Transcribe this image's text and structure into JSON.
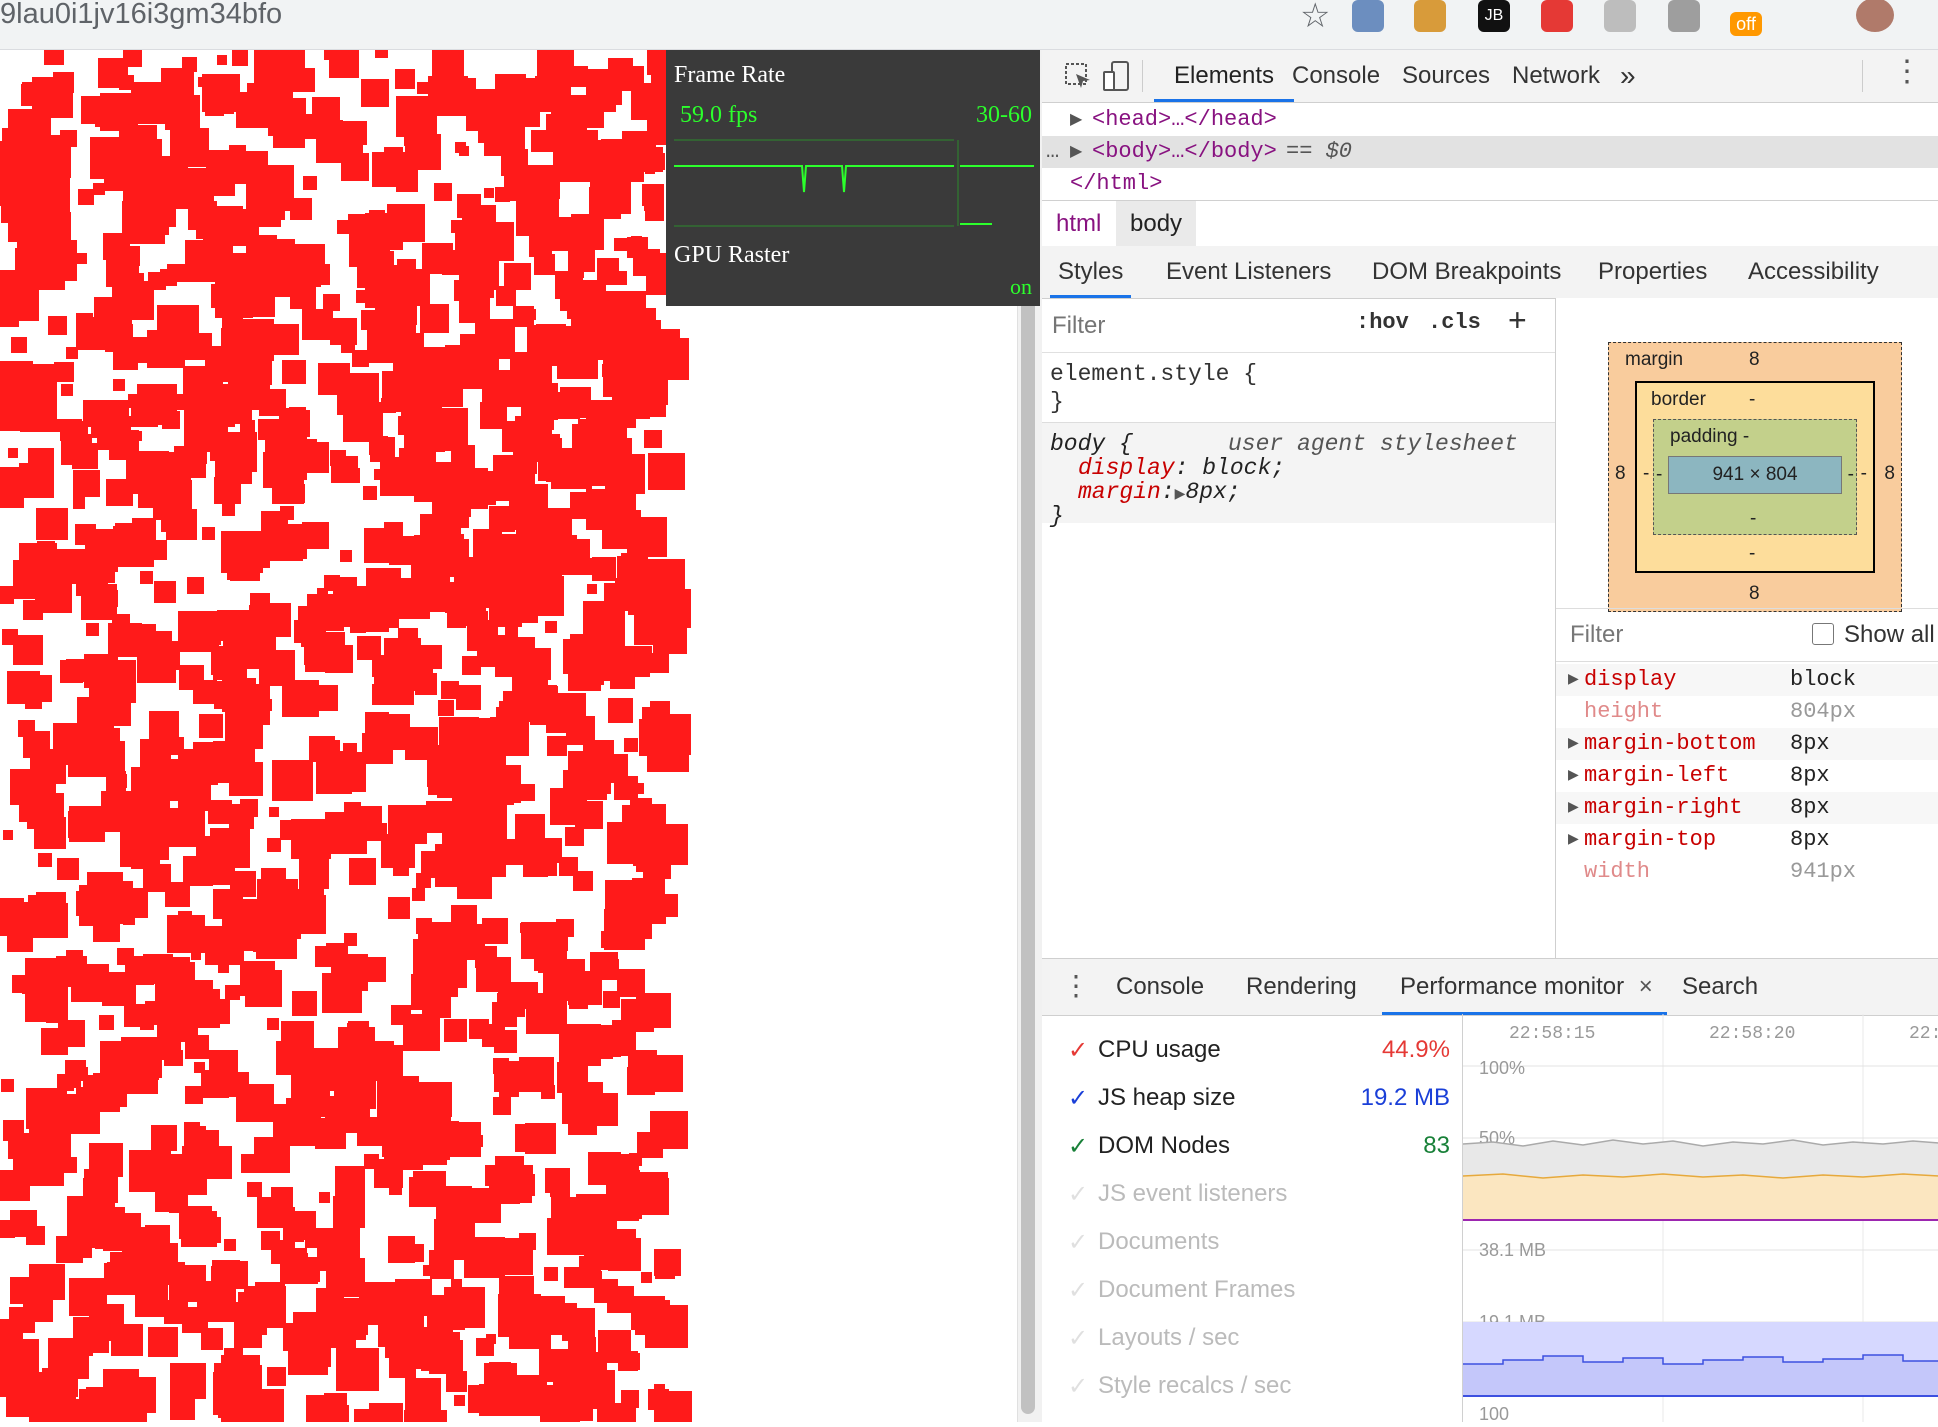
{
  "browser": {
    "url_fragment": "9lau0i1jv16i3gm34bfo",
    "extensions": [
      {
        "name": "ext-image-icon",
        "color": "#6c8ebf",
        "text": ""
      },
      {
        "name": "cookie-icon",
        "color": "#d89b3a",
        "text": ""
      },
      {
        "name": "jetbrains-icon",
        "color": "#111111",
        "text": "JB"
      },
      {
        "name": "adblock-icon",
        "color": "#e53935",
        "text": ""
      },
      {
        "name": "ext-grey-icon",
        "color": "#bdbdbd",
        "text": ""
      },
      {
        "name": "tree-icon",
        "color": "#9e9e9e",
        "text": ""
      },
      {
        "name": "off-badge-icon",
        "color": "#ff9800",
        "text": "off"
      },
      {
        "name": "profile-avatar",
        "color": "#b07a6a",
        "text": ""
      }
    ]
  },
  "fps_meter": {
    "title": "Frame Rate",
    "fps": "59.0 fps",
    "range": "30-60",
    "gpu_title": "GPU Raster",
    "gpu_status": "on"
  },
  "devtools": {
    "tabs": [
      "Elements",
      "Console",
      "Sources",
      "Network",
      "»"
    ],
    "dom": {
      "head": "<head>…</head>",
      "body": "<body>…</body>",
      "selected_suffix": "== $0",
      "html_close": "</html>"
    },
    "breadcrumbs": [
      "html",
      "body"
    ],
    "sub_tabs": [
      "Styles",
      "Event Listeners",
      "DOM Breakpoints",
      "Properties",
      "Accessibility"
    ],
    "styles": {
      "filter_placeholder": "Filter",
      "hov": ":hov",
      "cls": ".cls",
      "plus": "+",
      "element_style_selector": "element.style {",
      "close_brace": "}",
      "body_selector": "body {",
      "origin": "user agent stylesheet",
      "props": [
        {
          "name": "display",
          "value": "block;"
        },
        {
          "name": "margin",
          "value": "8px;"
        }
      ]
    },
    "box_model": {
      "margin_label": "margin",
      "margin_top": "8",
      "margin_bottom": "8",
      "margin_left": "8",
      "margin_right": "8",
      "border_label": "border",
      "border_top": "-",
      "border_bottom": "-",
      "border_side": "-",
      "padding_label": "padding -",
      "padding_bottom": "-",
      "padding_side": "-",
      "content": "941 × 804"
    },
    "computed": {
      "filter_placeholder": "Filter",
      "show_all": "Show all",
      "rows": [
        {
          "name": "display",
          "value": "block",
          "expandable": true,
          "inherited": false
        },
        {
          "name": "height",
          "value": "804px",
          "expandable": false,
          "inherited": true
        },
        {
          "name": "margin-bottom",
          "value": "8px",
          "expandable": true,
          "inherited": false
        },
        {
          "name": "margin-left",
          "value": "8px",
          "expandable": true,
          "inherited": false
        },
        {
          "name": "margin-right",
          "value": "8px",
          "expandable": true,
          "inherited": false
        },
        {
          "name": "margin-top",
          "value": "8px",
          "expandable": true,
          "inherited": false
        },
        {
          "name": "width",
          "value": "941px",
          "expandable": false,
          "inherited": true
        }
      ]
    },
    "drawer_tabs": [
      "Console",
      "Rendering",
      "Performance monitor",
      "Search"
    ],
    "drawer_close": "×",
    "perf_metrics": [
      {
        "label": "CPU usage",
        "value": "44.9%",
        "checked": true,
        "color": "#e53935"
      },
      {
        "label": "JS heap size",
        "value": "19.2 MB",
        "checked": true,
        "color": "#1a3fd8"
      },
      {
        "label": "DOM Nodes",
        "value": "83",
        "checked": true,
        "color": "#188038"
      },
      {
        "label": "JS event listeners",
        "value": "",
        "checked": false,
        "color": "#cccccc"
      },
      {
        "label": "Documents",
        "value": "",
        "checked": false,
        "color": "#cccccc"
      },
      {
        "label": "Document Frames",
        "value": "",
        "checked": false,
        "color": "#cccccc"
      },
      {
        "label": "Layouts / sec",
        "value": "",
        "checked": false,
        "color": "#cccccc"
      },
      {
        "label": "Style recalcs / sec",
        "value": "",
        "checked": false,
        "color": "#cccccc"
      }
    ],
    "perf_chart": {
      "times": [
        "22:58:15",
        "22:58:20",
        "22:"
      ],
      "cpu_labels": [
        "100%",
        "50%"
      ],
      "heap_labels": [
        "38.1 MB",
        "19.1 MB"
      ],
      "dom_label": "100"
    }
  }
}
